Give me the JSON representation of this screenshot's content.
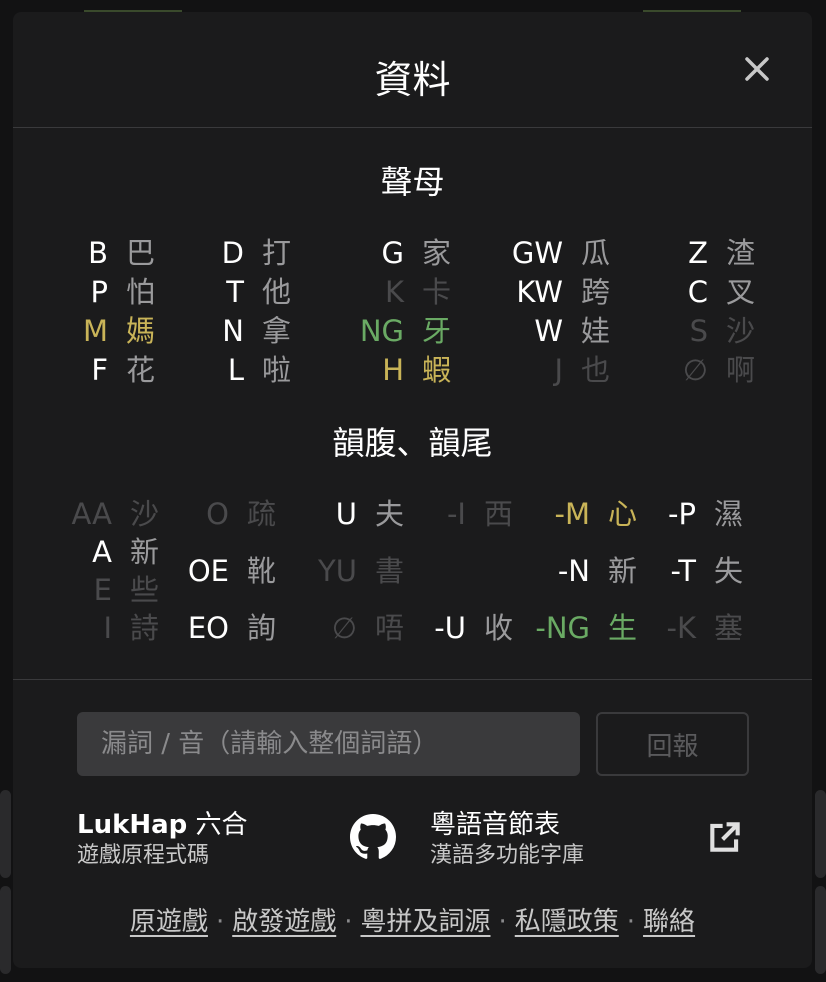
{
  "modal": {
    "title": "資料",
    "close_label": "×"
  },
  "initials": {
    "title": "聲母",
    "columns": [
      [
        {
          "code": "B",
          "han": "巴",
          "state": "normal"
        },
        {
          "code": "P",
          "han": "怕",
          "state": "normal"
        },
        {
          "code": "M",
          "han": "媽",
          "state": "present"
        },
        {
          "code": "F",
          "han": "花",
          "state": "normal"
        }
      ],
      [
        {
          "code": "D",
          "han": "打",
          "state": "normal"
        },
        {
          "code": "T",
          "han": "他",
          "state": "normal"
        },
        {
          "code": "N",
          "han": "拿",
          "state": "normal"
        },
        {
          "code": "L",
          "han": "啦",
          "state": "normal"
        }
      ],
      [
        {
          "code": "G",
          "han": "家",
          "state": "normal"
        },
        {
          "code": "K",
          "han": "卡",
          "state": "absent"
        },
        {
          "code": "NG",
          "han": "牙",
          "state": "correct"
        },
        {
          "code": "H",
          "han": "蝦",
          "state": "present"
        }
      ],
      [
        {
          "code": "GW",
          "han": "瓜",
          "state": "normal"
        },
        {
          "code": "KW",
          "han": "跨",
          "state": "normal"
        },
        {
          "code": "W",
          "han": "娃",
          "state": "normal"
        },
        {
          "code": "J",
          "han": "也",
          "state": "absent"
        }
      ],
      [
        {
          "code": "Z",
          "han": "渣",
          "state": "normal"
        },
        {
          "code": "C",
          "han": "叉",
          "state": "normal"
        },
        {
          "code": "S",
          "han": "沙",
          "state": "absent"
        },
        {
          "code": "∅",
          "han": "啊",
          "state": "absent"
        }
      ]
    ]
  },
  "finals": {
    "title": "韻腹、韻尾",
    "col1": [
      {
        "code": "AA",
        "han": "沙",
        "state": "absent"
      },
      {
        "code": "A",
        "han": "新",
        "state": "normal"
      },
      {
        "code": "E",
        "han": "些",
        "state": "absent"
      },
      {
        "code": "I",
        "han": "詩",
        "state": "absent"
      }
    ],
    "col2": [
      {
        "code": "O",
        "han": "疏",
        "state": "absent"
      },
      {
        "code": "OE",
        "han": "靴",
        "state": "normal"
      },
      {
        "code": "EO",
        "han": "詢",
        "state": "normal"
      }
    ],
    "col3": [
      {
        "code": "U",
        "han": "夫",
        "state": "normal"
      },
      {
        "code": "YU",
        "han": "書",
        "state": "absent"
      },
      {
        "code": "∅",
        "han": "唔",
        "state": "absent"
      }
    ],
    "col4": [
      {
        "code": "-I",
        "han": "西",
        "state": "absent"
      },
      {
        "code": "-U",
        "han": "收",
        "state": "normal"
      }
    ],
    "col5": [
      {
        "code": "-M",
        "han": "心",
        "state": "present"
      },
      {
        "code": "-N",
        "han": "新",
        "state": "normal"
      },
      {
        "code": "-NG",
        "han": "生",
        "state": "correct"
      }
    ],
    "col6": [
      {
        "code": "-P",
        "han": "濕",
        "state": "normal"
      },
      {
        "code": "-T",
        "han": "失",
        "state": "normal"
      },
      {
        "code": "-K",
        "han": "塞",
        "state": "absent"
      }
    ]
  },
  "report": {
    "placeholder": "漏詞 / 音（請輸入整個詞語）",
    "value": "",
    "button_label": "回報"
  },
  "links": {
    "lukhap": {
      "title_bold": "LukHap",
      "title_rest": " 六合",
      "subtitle": "遊戲原程式碼"
    },
    "jyutping": {
      "title": "粵語音節表",
      "subtitle": "漢語多功能字庫"
    }
  },
  "footer": {
    "items": [
      "原遊戲",
      "啟發遊戲",
      "粵拼及詞源",
      "私隱政策",
      "聯絡"
    ],
    "separator": "·"
  },
  "colors": {
    "background": "#121213",
    "modal": "#1b1b1c",
    "correct": "#6aaa64",
    "present": "#c9b458",
    "absent": "#4a4a4c",
    "han": "#9a9a9c"
  }
}
